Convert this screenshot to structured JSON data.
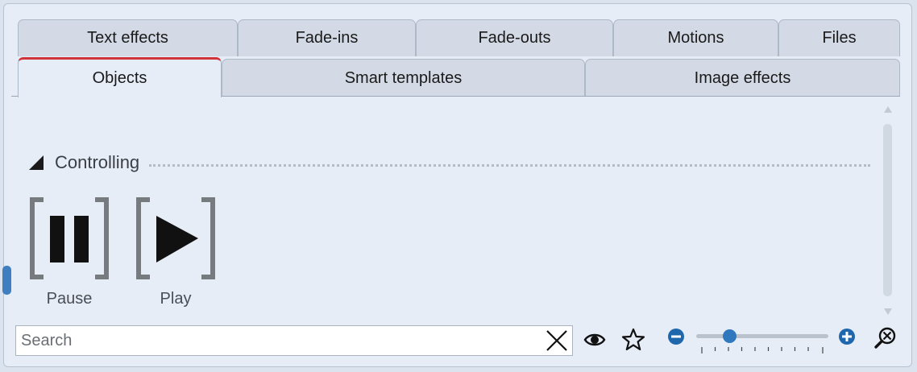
{
  "tabs_row1": [
    {
      "label": "Text effects"
    },
    {
      "label": "Fade-ins"
    },
    {
      "label": "Fade-outs"
    },
    {
      "label": "Motions"
    },
    {
      "label": "Files"
    }
  ],
  "tabs_row2": [
    {
      "label": "Objects",
      "active": true
    },
    {
      "label": "Smart templates"
    },
    {
      "label": "Image effects"
    }
  ],
  "section": {
    "title": "Controlling"
  },
  "items": [
    {
      "label": "Pause",
      "icon": "pause-icon"
    },
    {
      "label": "Play",
      "icon": "play-icon"
    }
  ],
  "search": {
    "placeholder": "Search",
    "value": ""
  },
  "toolbar": {
    "icons": [
      "eye-icon",
      "star-icon",
      "zoom-out-icon",
      "zoom-in-icon",
      "zoom-reset-icon"
    ]
  },
  "zoom": {
    "level": 0.2
  },
  "colors": {
    "active_tab_accent": "#d1333a",
    "slider": "#2f78bd"
  }
}
